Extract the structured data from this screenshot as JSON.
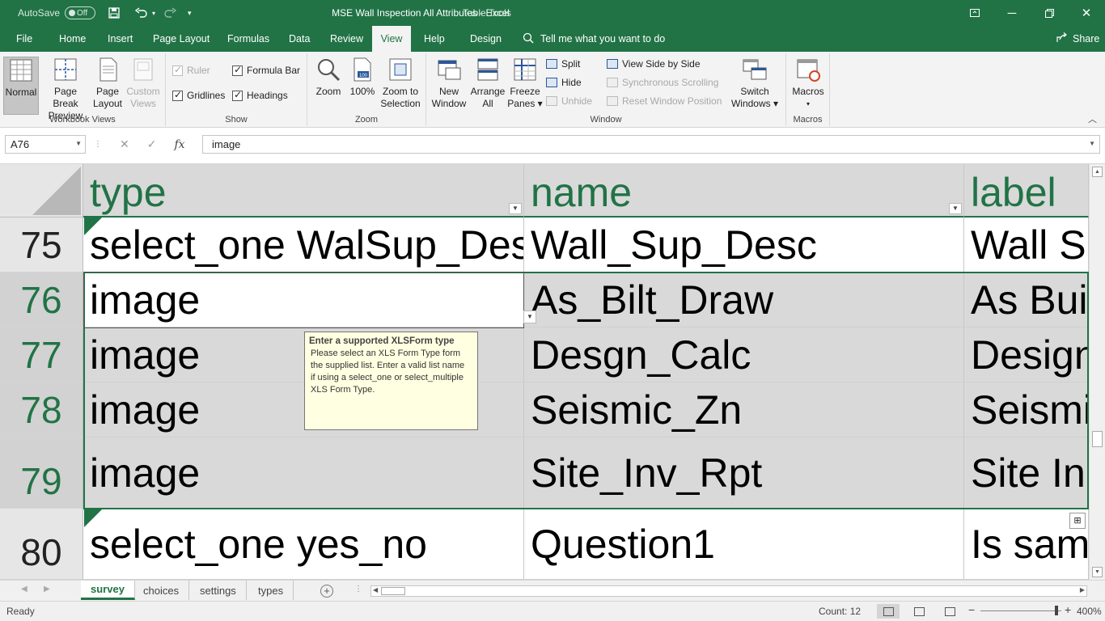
{
  "titlebar": {
    "autosave_label": "AutoSave",
    "autosave_state": "Off",
    "document_title": "MSE Wall Inspection All Attributes  -  Excel",
    "context_label": "Table Tools"
  },
  "tabs": [
    "File",
    "Home",
    "Insert",
    "Page Layout",
    "Formulas",
    "Data",
    "Review",
    "View",
    "Help",
    "Design"
  ],
  "active_tab": "View",
  "tell_me": "Tell me what you want to do",
  "share": "Share",
  "ribbon": {
    "workbook_views": {
      "label": "Workbook Views",
      "normal": "Normal",
      "page_break_preview": [
        "Page Break",
        "Preview"
      ],
      "page_layout": [
        "Page",
        "Layout"
      ],
      "custom_views": [
        "Custom",
        "Views"
      ]
    },
    "show": {
      "label": "Show",
      "ruler": "Ruler",
      "formula_bar": "Formula Bar",
      "gridlines": "Gridlines",
      "headings": "Headings"
    },
    "zoom": {
      "label": "Zoom",
      "zoom": "Zoom",
      "hundred": "100%",
      "zoom_to_selection": [
        "Zoom to",
        "Selection"
      ]
    },
    "window": {
      "label": "Window",
      "new_window": [
        "New",
        "Window"
      ],
      "arrange_all": [
        "Arrange",
        "All"
      ],
      "freeze_panes": [
        "Freeze",
        "Panes"
      ],
      "split": "Split",
      "hide": "Hide",
      "unhide": "Unhide",
      "view_side_by_side": "View Side by Side",
      "synchronous_scrolling": "Synchronous Scrolling",
      "reset_window_position": "Reset Window Position",
      "switch_windows": [
        "Switch",
        "Windows"
      ]
    },
    "macros": {
      "label": "Macros",
      "macros": "Macros"
    }
  },
  "formula_bar": {
    "name_box": "A76",
    "formula": "image"
  },
  "grid": {
    "headers": [
      "type",
      "name",
      "label"
    ],
    "rows": [
      {
        "num": "75",
        "cells": [
          "select_one WalSup_Desc",
          "Wall_Sup_Desc",
          "Wall Sup"
        ]
      },
      {
        "num": "76",
        "cells": [
          "image",
          "As_Bilt_Draw",
          "As Built"
        ]
      },
      {
        "num": "77",
        "cells": [
          "image",
          "Desgn_Calc",
          "Design"
        ]
      },
      {
        "num": "78",
        "cells": [
          "image",
          "Seismic_Zn",
          "Seismic"
        ]
      },
      {
        "num": "79",
        "cells": [
          "image",
          "Site_Inv_Rpt",
          "Site In"
        ]
      },
      {
        "num": "80",
        "cells": [
          "select_one yes_no",
          "Question1",
          "Is same"
        ]
      }
    ]
  },
  "tooltip": {
    "title": "Enter a supported XLSForm type",
    "lines": [
      "Please select an XLS Form Type form",
      "the supplied list. Enter a valid list name",
      "if using a select_one or select_multiple",
      "XLS Form Type."
    ]
  },
  "sheets": [
    "survey",
    "choices",
    "settings",
    "types"
  ],
  "active_sheet": "survey",
  "status": {
    "ready": "Ready",
    "count": "Count: 12",
    "zoom": "400%"
  },
  "colors": {
    "excel_green": "#217346",
    "header_gray": "#d9d9d9",
    "tooltip_bg": "#ffffe1"
  }
}
